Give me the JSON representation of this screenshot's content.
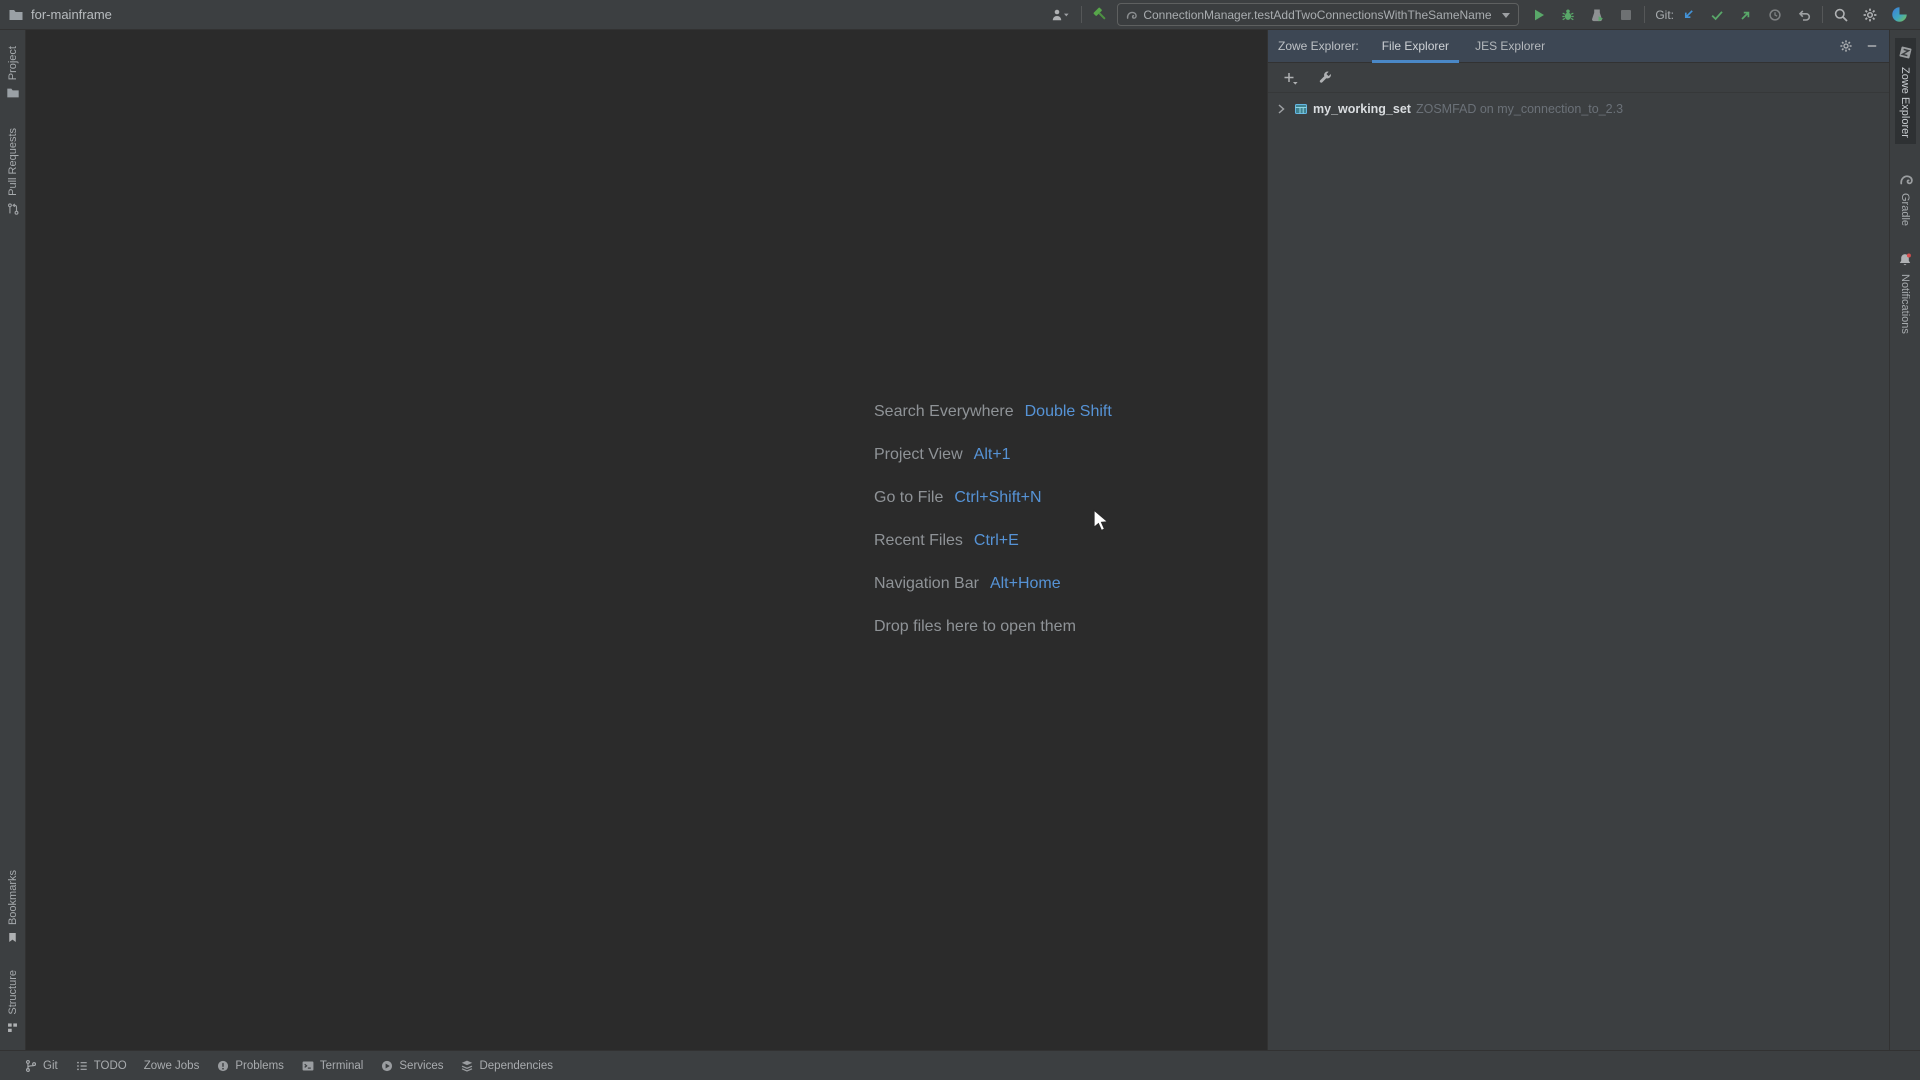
{
  "window": {
    "title": "for-mainframe"
  },
  "toolbar": {
    "run_config": "ConnectionManager.testAddTwoConnectionsWithTheSameName",
    "git_label": "Git:"
  },
  "left_stripe": {
    "top": [
      {
        "label": "Project",
        "icon": "folder-icon"
      },
      {
        "label": "Pull Requests",
        "icon": "pull-request-icon"
      }
    ],
    "bottom": [
      {
        "label": "Bookmarks",
        "icon": "bookmark-icon"
      },
      {
        "label": "Structure",
        "icon": "structure-icon"
      }
    ]
  },
  "right_stripe": {
    "items": [
      {
        "label": "Zowe Explorer",
        "icon": "zowe-z-icon",
        "active": true
      },
      {
        "label": "Gradle",
        "icon": "gradle-elephant-icon",
        "active": false
      },
      {
        "label": "Notifications",
        "icon": "bell-icon",
        "active": false,
        "badge": true
      }
    ]
  },
  "zowe_panel": {
    "title": "Zowe Explorer:",
    "tabs": [
      {
        "label": "File Explorer",
        "active": true
      },
      {
        "label": "JES Explorer",
        "active": false
      }
    ],
    "tree": {
      "name": "my_working_set",
      "detail": "ZOSMFAD on my_connection_to_2.3"
    }
  },
  "editor_overlay": {
    "shortcuts": [
      {
        "label": "Search Everywhere",
        "keys": "Double Shift"
      },
      {
        "label": "Project View",
        "keys": "Alt+1"
      },
      {
        "label": "Go to File",
        "keys": "Ctrl+Shift+N"
      },
      {
        "label": "Recent Files",
        "keys": "Ctrl+E"
      },
      {
        "label": "Navigation Bar",
        "keys": "Alt+Home"
      }
    ],
    "drop_hint": "Drop files here to open them"
  },
  "status_bar": {
    "items": [
      {
        "label": "Git",
        "icon": "git-branch-icon"
      },
      {
        "label": "TODO",
        "icon": "todo-list-icon"
      },
      {
        "label": "Zowe Jobs",
        "icon": ""
      },
      {
        "label": "Problems",
        "icon": "problems-icon"
      },
      {
        "label": "Terminal",
        "icon": "terminal-icon"
      },
      {
        "label": "Services",
        "icon": "services-icon"
      },
      {
        "label": "Dependencies",
        "icon": "dependencies-icon"
      }
    ]
  },
  "icons": {
    "folder-icon": "gray folder glyph",
    "user-accounts-icon": "person silhouette with dropdown caret",
    "build-hammer-icon": "green diagonal hammer",
    "gradle-elephant-icon": "gray elephant outline",
    "chevron-down-icon": "small down caret",
    "run-icon": "green play triangle",
    "debug-icon": "green bug",
    "coverage-icon": "gray flask with green arrow",
    "stop-icon": "gray square",
    "update-project-icon": "blue down-left arrow",
    "commit-icon": "green check mark",
    "push-icon": "green up-right arrow",
    "history-icon": "gray clock",
    "rollback-icon": "gray undo arrow",
    "search-icon": "magnifier",
    "gear-icon": "settings gear",
    "code-with-me-icon": "blue-green sphere",
    "add-icon": "plus with caret",
    "wrench-icon": "wrench",
    "minimize-icon": "horizontal bar",
    "chevron-right-icon": "collapsed tree arrow",
    "working-set-icon": "teal dataset grid square",
    "pull-request-icon": "branch with arrow and nodes",
    "bookmark-icon": "flag bookmark",
    "structure-icon": "small squares",
    "zowe-z-icon": "tilted tile with Z",
    "bell-icon": "notification bell with red dot",
    "git-branch-icon": "branch nodes",
    "todo-list-icon": "checklist lines",
    "problems-icon": "filled circle with exclamation",
    "terminal-icon": "terminal prompt box",
    "services-icon": "filled circle with play",
    "dependencies-icon": "stacked layers",
    "mouse-cursor": "white arrow pointer"
  },
  "colors": {
    "toolbar_bg": "#3c3f41",
    "editor_bg": "#2b2b2b",
    "panel_header_bg": "#3d4754",
    "tab_accent": "#4a88c7",
    "shortcut_blue": "#5693d6",
    "run_green": "#59a869",
    "update_blue": "#4393d8",
    "badge_red": "#d64f4f"
  }
}
